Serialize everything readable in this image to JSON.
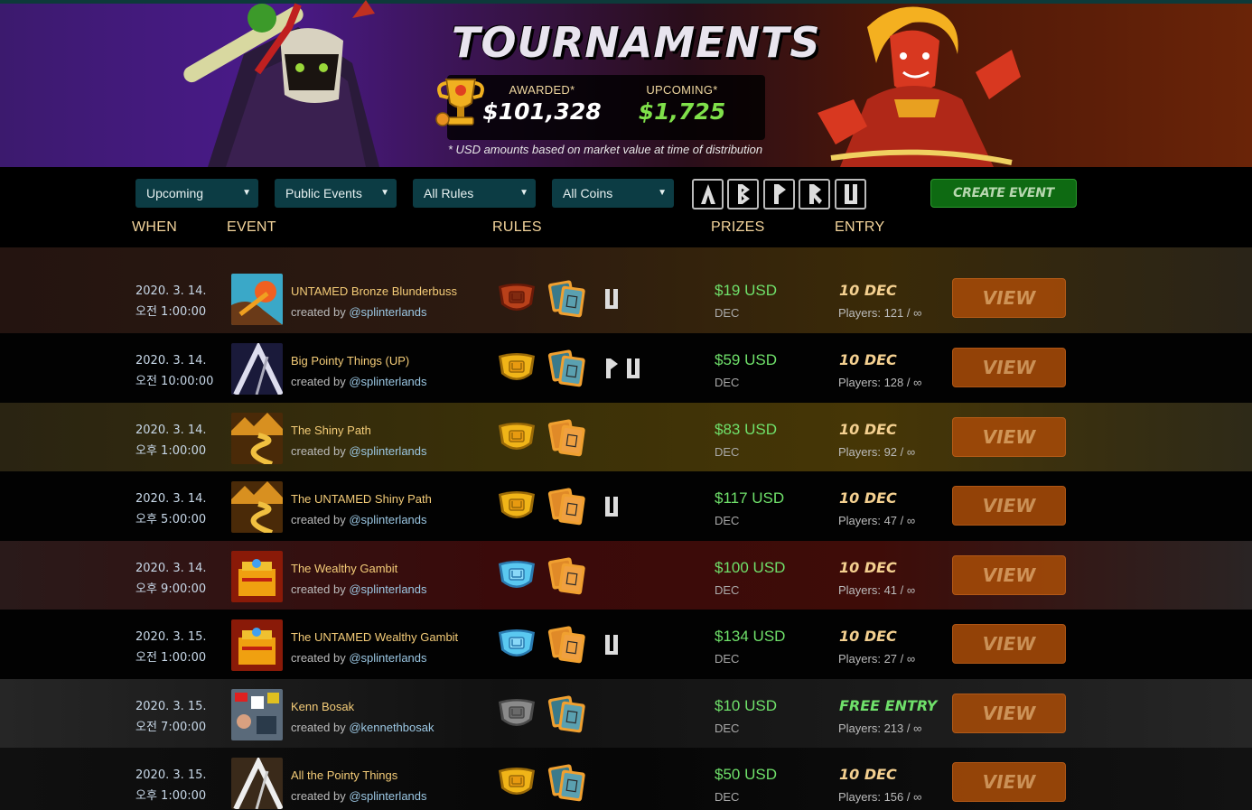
{
  "banner": {
    "title": "TOURNAMENTS",
    "awarded_label": "AWARDED*",
    "awarded_value": "$101,328",
    "upcoming_label": "UPCOMING*",
    "upcoming_value": "$1,725",
    "note": "* USD amounts based on market value at time of distribution"
  },
  "filters": {
    "status": "Upcoming",
    "visibility": "Public Events",
    "rules": "All Rules",
    "coins": "All Coins",
    "editions": [
      "alpha-edition-icon",
      "beta-edition-icon",
      "promo-edition-icon",
      "reward-edition-icon",
      "untamed-edition-icon"
    ],
    "create_label": "CREATE EVENT"
  },
  "columns": {
    "when": "WHEN",
    "event": "EVENT",
    "rules": "RULES",
    "prizes": "PRIZES",
    "entry": "ENTRY"
  },
  "rows": [
    {
      "date": "2020. 3. 14.",
      "time": "오전 1:00:00",
      "name": "UNTAMED Bronze Blunderbuss",
      "created_by": "created by",
      "creator": "@splinterlands",
      "league": "bronze",
      "deck": "blue",
      "editions": [
        "U"
      ],
      "prize": "$19 USD",
      "prize_unit": "DEC",
      "entry": "10 DEC",
      "players": "Players: 121 / ∞",
      "view": "VIEW",
      "thumb": "blunderbuss"
    },
    {
      "date": "2020. 3. 14.",
      "time": "오전 10:00:00",
      "name": "Big Pointy Things (UP)",
      "created_by": "created by",
      "creator": "@splinterlands",
      "league": "gold",
      "deck": "blue",
      "editions": [
        "P",
        "U"
      ],
      "prize": "$59 USD",
      "prize_unit": "DEC",
      "entry": "10 DEC",
      "players": "Players: 128 / ∞",
      "view": "VIEW",
      "thumb": "pointy"
    },
    {
      "date": "2020. 3. 14.",
      "time": "오후 1:00:00",
      "name": "The Shiny Path",
      "created_by": "created by",
      "creator": "@splinterlands",
      "league": "gold",
      "deck": "orange",
      "editions": [],
      "prize": "$83 USD",
      "prize_unit": "DEC",
      "entry": "10 DEC",
      "players": "Players: 92 / ∞",
      "view": "VIEW",
      "thumb": "path"
    },
    {
      "date": "2020. 3. 14.",
      "time": "오후 5:00:00",
      "name": "The UNTAMED Shiny Path",
      "created_by": "created by",
      "creator": "@splinterlands",
      "league": "gold",
      "deck": "orange",
      "editions": [
        "U"
      ],
      "prize": "$117 USD",
      "prize_unit": "DEC",
      "entry": "10 DEC",
      "players": "Players: 47 / ∞",
      "view": "VIEW",
      "thumb": "path"
    },
    {
      "date": "2020. 3. 14.",
      "time": "오후 9:00:00",
      "name": "The Wealthy Gambit",
      "created_by": "created by",
      "creator": "@splinterlands",
      "league": "diamond",
      "deck": "orange",
      "editions": [],
      "prize": "$100 USD",
      "prize_unit": "DEC",
      "entry": "10 DEC",
      "players": "Players: 41 / ∞",
      "view": "VIEW",
      "thumb": "gambit"
    },
    {
      "date": "2020. 3. 15.",
      "time": "오전 1:00:00",
      "name": "The UNTAMED Wealthy Gambit",
      "created_by": "created by",
      "creator": "@splinterlands",
      "league": "diamond",
      "deck": "orange",
      "editions": [
        "U"
      ],
      "prize": "$134 USD",
      "prize_unit": "DEC",
      "entry": "10 DEC",
      "players": "Players: 27 / ∞",
      "view": "VIEW",
      "thumb": "gambit"
    },
    {
      "date": "2020. 3. 15.",
      "time": "오전 7:00:00",
      "name": "Kenn Bosak",
      "created_by": "created by",
      "creator": "@kennethbosak",
      "league": "silver",
      "deck": "blue",
      "editions": [],
      "prize": "$10 USD",
      "prize_unit": "DEC",
      "entry": "FREE ENTRY",
      "players": "Players: 213 / ∞",
      "view": "VIEW",
      "thumb": "kenn"
    },
    {
      "date": "2020. 3. 15.",
      "time": "오후 1:00:00",
      "name": "All the Pointy Things",
      "created_by": "created by",
      "creator": "@splinterlands",
      "league": "gold",
      "deck": "blue",
      "editions": [],
      "prize": "$50 USD",
      "prize_unit": "DEC",
      "entry": "10 DEC",
      "players": "Players: 156 / ∞",
      "view": "VIEW",
      "thumb": "pointy2"
    }
  ],
  "colors": {
    "prize": "#6fe06a",
    "entry": "#f4d090",
    "view_button": "#a34a08",
    "create_button": "#0e6a12",
    "select_bg": "#0c3c44"
  }
}
